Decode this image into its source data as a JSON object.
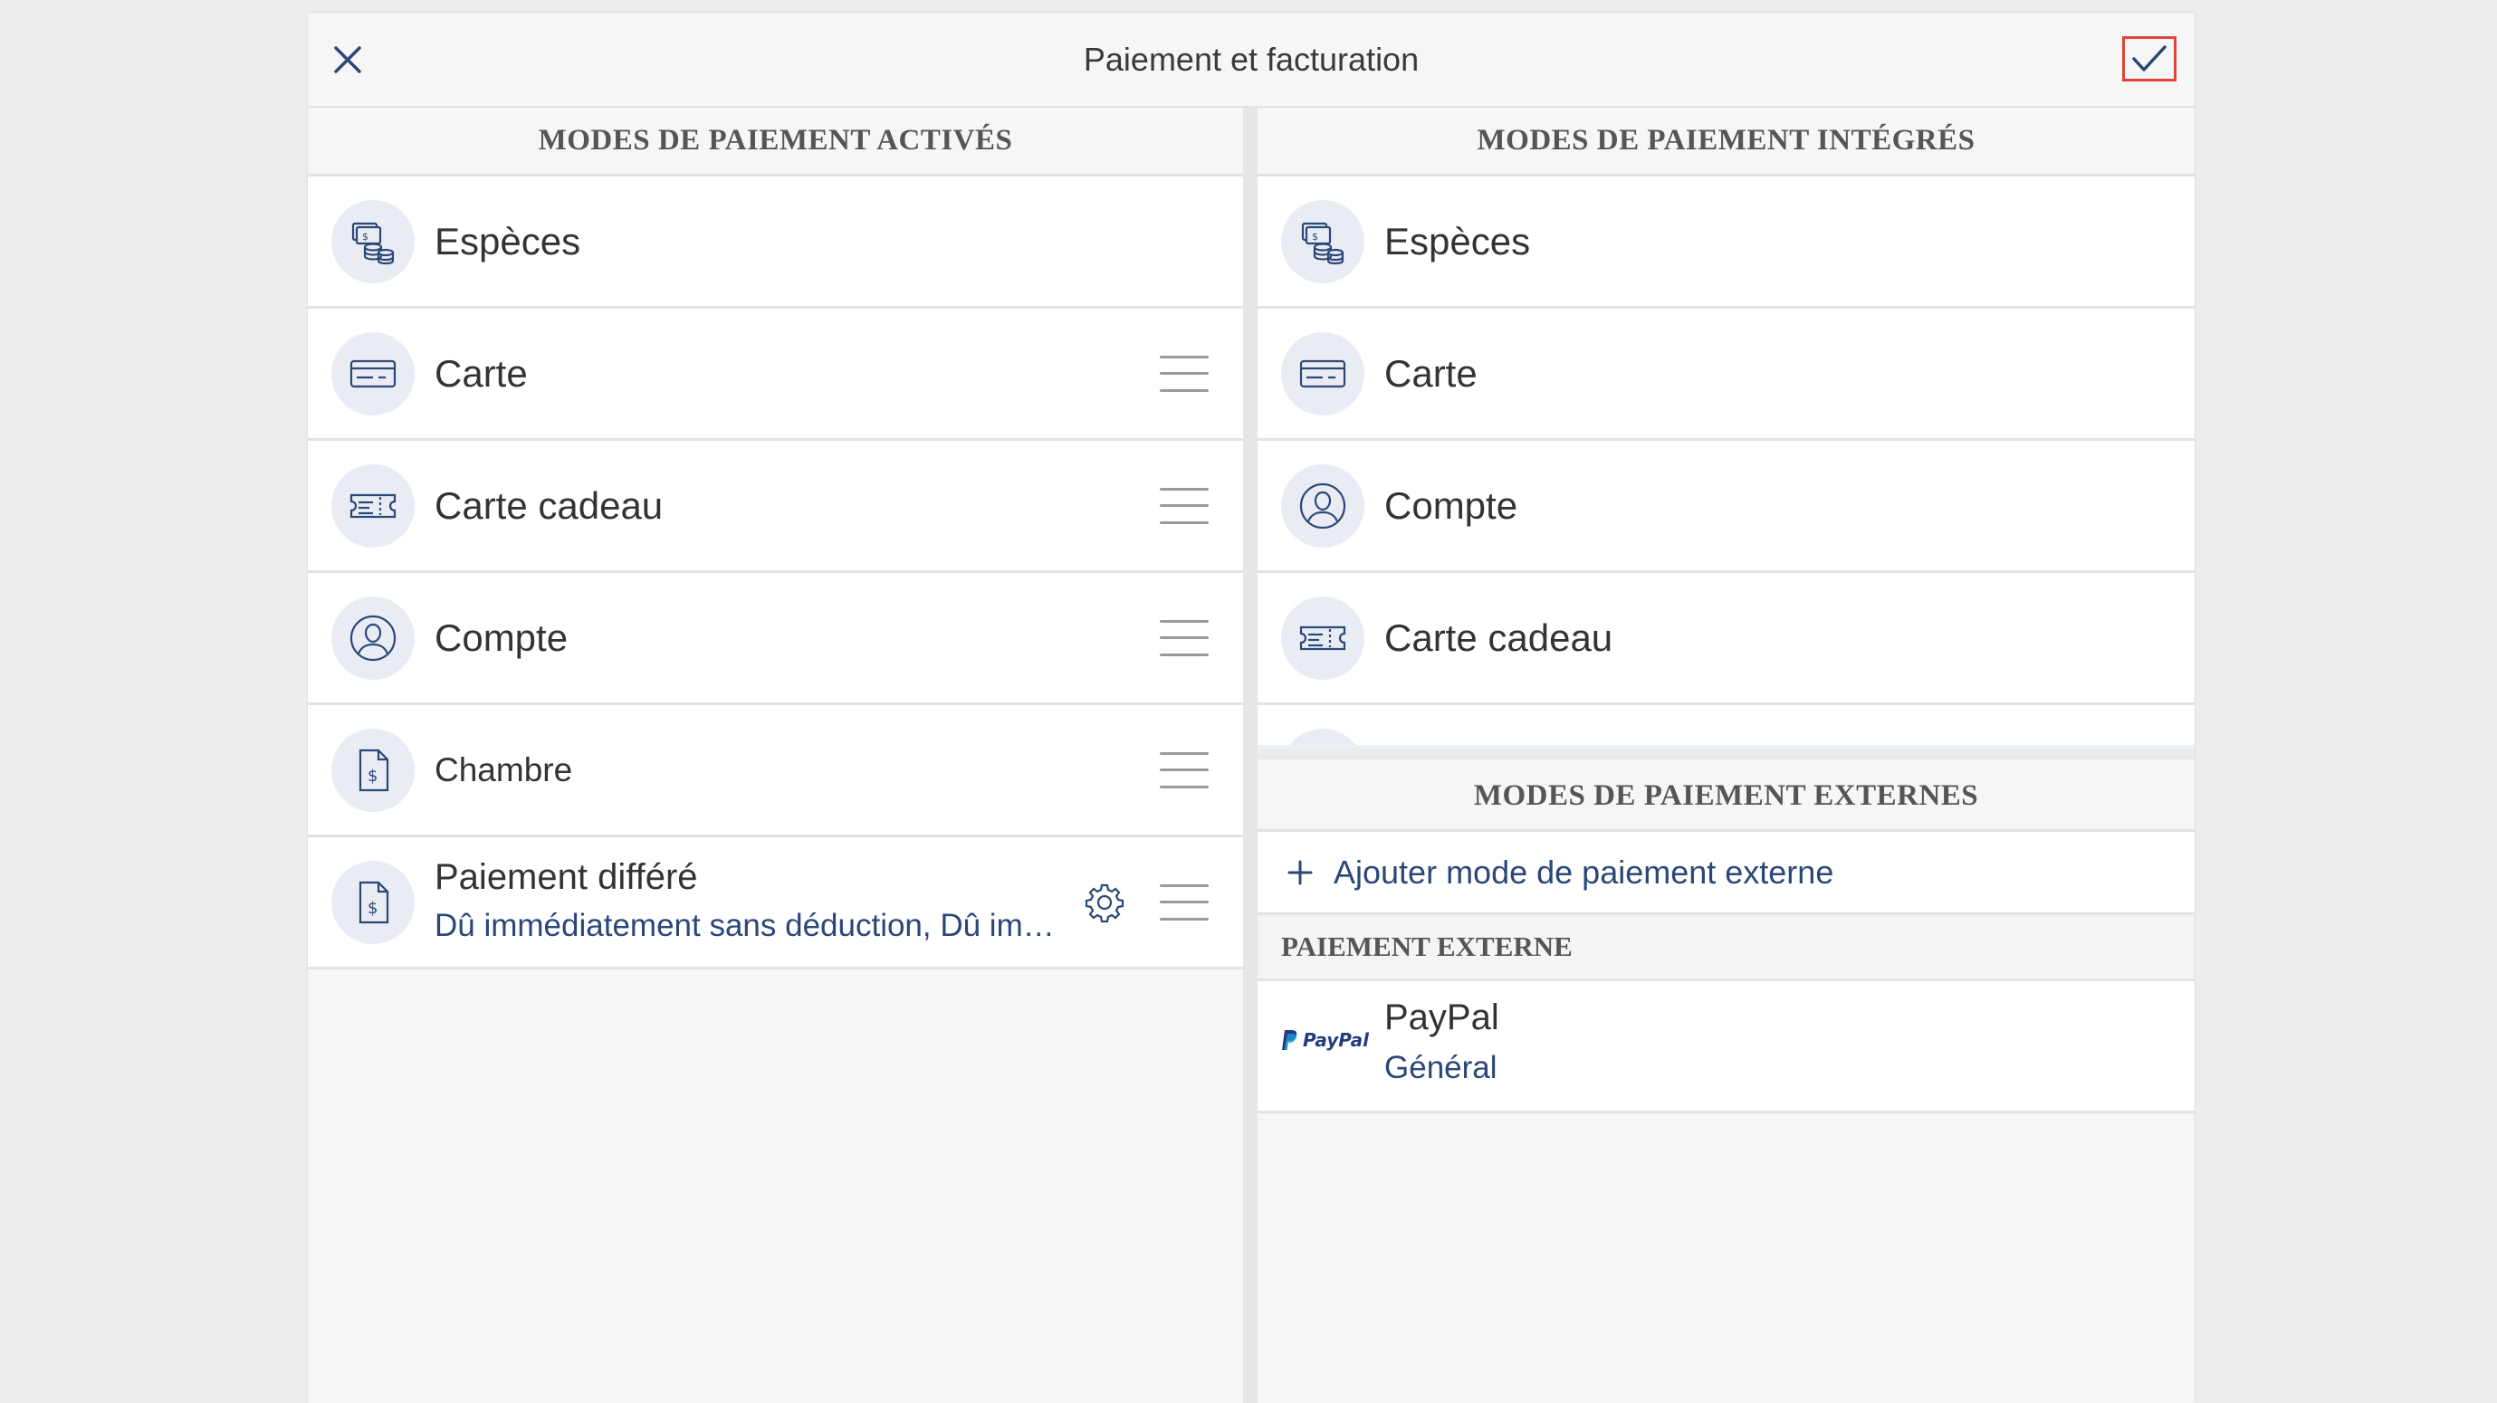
{
  "header": {
    "title": "Paiement et facturation",
    "close_icon": "close-icon",
    "confirm_icon": "checkmark-icon",
    "accent": "#2b4778",
    "highlight": "#e0453a"
  },
  "activated": {
    "title": "MODES DE PAIEMENT ACTIVÉS",
    "items": [
      {
        "label": "Espèces",
        "icon": "cash-icon"
      },
      {
        "label": "Carte",
        "icon": "card-icon"
      },
      {
        "label": "Carte cadeau",
        "icon": "gift-card-icon"
      },
      {
        "label": "Compte",
        "icon": "account-icon"
      },
      {
        "label": "Chambre",
        "icon": "room-invoice-icon"
      },
      {
        "label": "Paiement différé",
        "sub": "Dû immédiatement sans déduction, Dû immédiatement sans déduction",
        "icon": "deferred-invoice-icon"
      }
    ]
  },
  "integrated": {
    "title": "MODES DE PAIEMENT INTÉGRÉS",
    "items": [
      {
        "label": "Espèces",
        "icon": "cash-icon"
      },
      {
        "label": "Carte",
        "icon": "card-icon"
      },
      {
        "label": "Compte",
        "icon": "account-icon"
      },
      {
        "label": "Carte cadeau",
        "icon": "gift-card-icon"
      }
    ]
  },
  "external": {
    "title": "MODES DE PAIEMENT EXTERNES",
    "add_label": "Ajouter mode de paiement externe",
    "group_title": "PAIEMENT EXTERNE",
    "items": [
      {
        "label": "PayPal",
        "sub": "Général",
        "logo_text": "PayPal"
      }
    ]
  }
}
